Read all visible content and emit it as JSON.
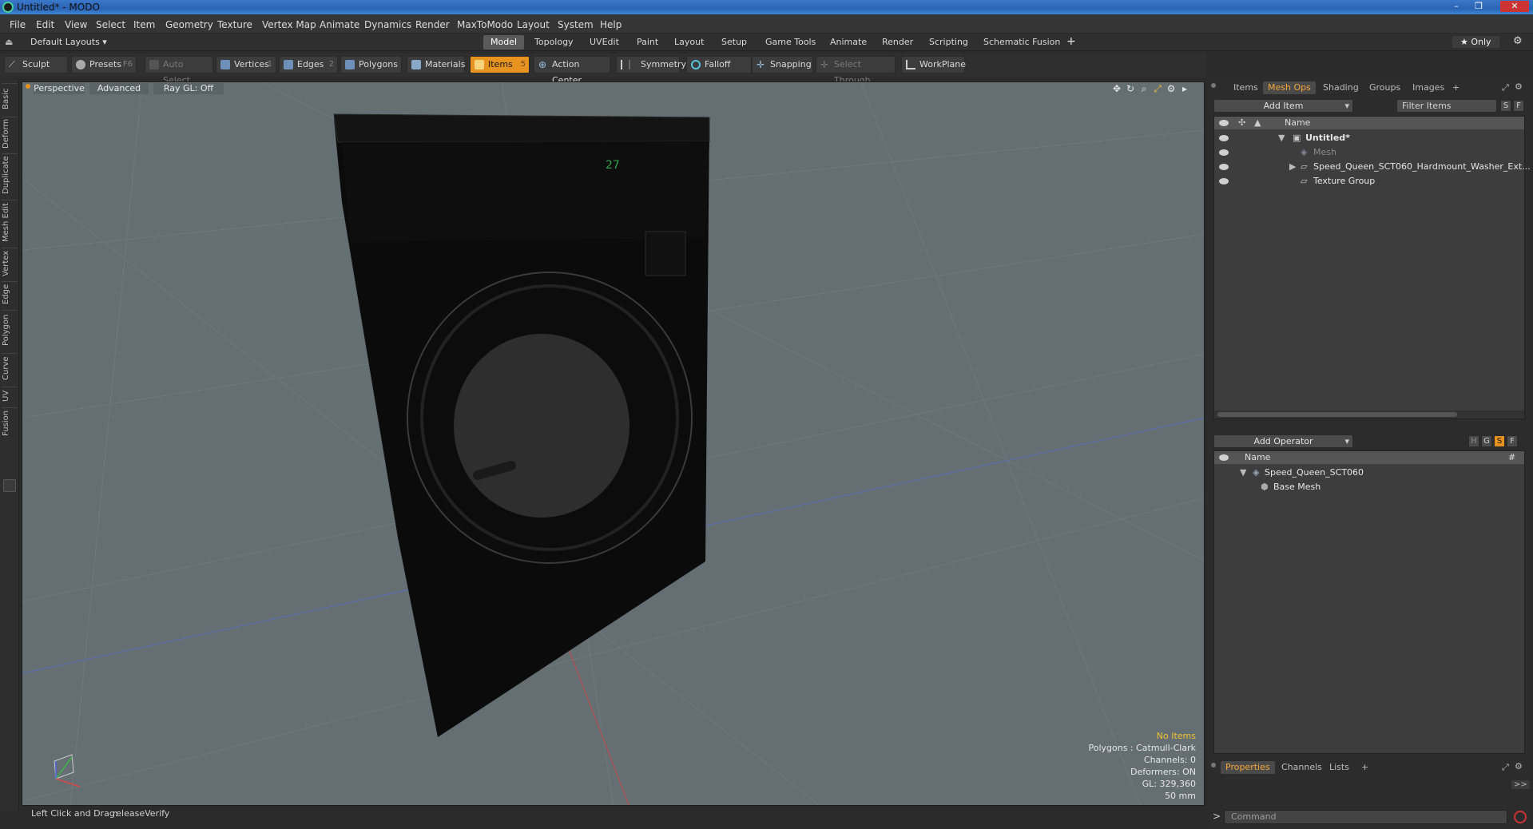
{
  "window": {
    "title": "Untitled* - MODO",
    "minimize": "–",
    "maximize": "❐",
    "close": "✕"
  },
  "menu": [
    "File",
    "Edit",
    "View",
    "Select",
    "Item",
    "Geometry",
    "Texture",
    "Vertex Map",
    "Animate",
    "Dynamics",
    "Render",
    "MaxToModo",
    "Layout",
    "System",
    "Help"
  ],
  "layouts": {
    "dropdown": "Default Layouts ▾",
    "tabs": [
      "Model",
      "Topology",
      "UVEdit",
      "Paint",
      "Layout",
      "Setup",
      "Game Tools",
      "Animate",
      "Render",
      "Scripting",
      "Schematic Fusion"
    ],
    "active_tab": "Model",
    "add": "+",
    "only": "★ Only",
    "settings_icon": "gear-icon"
  },
  "toolbar": {
    "sculpt": "Sculpt",
    "presets": "Presets",
    "presets_key": "F6",
    "auto_select": "Auto Select",
    "vertices": "Vertices",
    "vertices_key": "1",
    "edges": "Edges",
    "edges_key": "2",
    "polygons": "Polygons",
    "materials": "Materials",
    "items": "Items",
    "items_key": "5",
    "action_center": "Action Center",
    "symmetry": "Symmetry",
    "falloff": "Falloff",
    "snapping": "Snapping",
    "select_through": "Select Through",
    "workplane": "WorkPlane"
  },
  "left_tabs": [
    "Basic",
    "Deform",
    "Duplicate",
    "Mesh Edit",
    "Vertex",
    "Edge",
    "Polygon",
    "Curve",
    "UV",
    "Fusion"
  ],
  "viewport": {
    "view": "Perspective",
    "shading": "Advanced",
    "raygl": "Ray GL: Off",
    "display_digits": "27",
    "stats": {
      "no_items": "No Items",
      "polygons": "Polygons : Catmull-Clark",
      "channels": "Channels: 0",
      "deformers": "Deformers: ON",
      "gl": "GL: 329,360",
      "size": "50 mm"
    }
  },
  "status": {
    "hint": "Left Click and Drag:",
    "action": "releaseVerify"
  },
  "items_panel": {
    "tabs": [
      "Items",
      "Mesh Ops",
      "Shading",
      "Groups",
      "Images"
    ],
    "active_tab": "Mesh Ops",
    "add_item": "Add Item",
    "filter_placeholder": "Filter Items",
    "s_btn": "S",
    "f_btn": "F",
    "name_header": "Name",
    "tree": [
      {
        "label": "Untitled*",
        "bold": true
      },
      {
        "label": "Mesh",
        "dim": true
      },
      {
        "label": "Speed_Queen_SCT060_Hardmount_Washer_Ext..."
      },
      {
        "label": "Texture Group"
      }
    ]
  },
  "operator_panel": {
    "add_operator": "Add Operator",
    "h_btn": "H",
    "g_btn": "G",
    "s_btn": "S",
    "f_btn": "F",
    "name_header": "Name",
    "hash_header": "#",
    "tree": [
      {
        "label": "Speed_Queen_SCT060"
      },
      {
        "label": "Base Mesh"
      }
    ]
  },
  "properties_panel": {
    "tabs": [
      "Properties",
      "Channels",
      "Lists"
    ],
    "active_tab": "Properties",
    "expand": ">>"
  },
  "command": {
    "prompt": ">",
    "placeholder": "Command"
  },
  "colors": {
    "accent": "#e8931f",
    "viewport_bg": "#646e73",
    "panel_bg": "#2c2c2c"
  }
}
